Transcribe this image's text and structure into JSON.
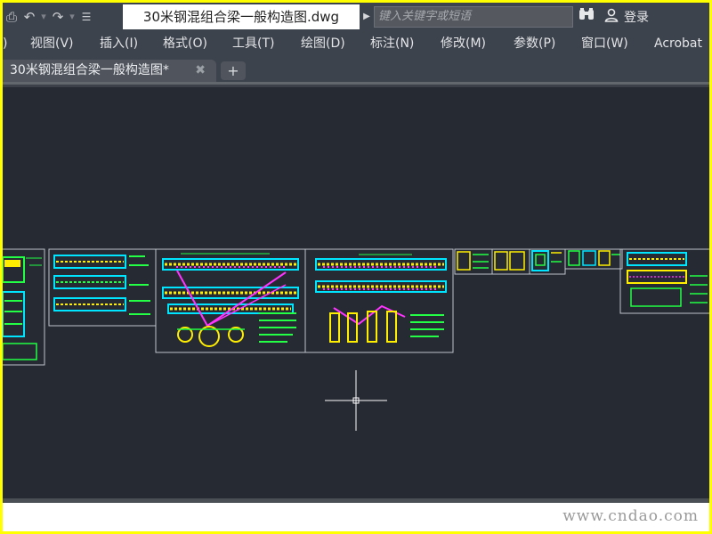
{
  "titlebar": {
    "qat_icons": [
      "print-icon",
      "undo-icon",
      "redo-icon",
      "customize-icon"
    ],
    "document_title": "30米钢混组合梁一般构造图.dwg",
    "search_placeholder": "键入关键字或短语",
    "login_label": "登录"
  },
  "menu": {
    "items": [
      {
        "label": ")",
        "name": "menu-partial"
      },
      {
        "label": "视图(V)",
        "name": "menu-view"
      },
      {
        "label": "插入(I)",
        "name": "menu-insert"
      },
      {
        "label": "格式(O)",
        "name": "menu-format"
      },
      {
        "label": "工具(T)",
        "name": "menu-tools"
      },
      {
        "label": "绘图(D)",
        "name": "menu-draw"
      },
      {
        "label": "标注(N)",
        "name": "menu-dimension"
      },
      {
        "label": "修改(M)",
        "name": "menu-modify"
      },
      {
        "label": "参数(P)",
        "name": "menu-parametric"
      },
      {
        "label": "窗口(W)",
        "name": "menu-window"
      },
      {
        "label": "Acrobat",
        "name": "menu-acrobat"
      }
    ]
  },
  "tabs": {
    "active_label": "30米钢混组合梁一般构造图*",
    "close_glyph": "✖",
    "new_glyph": "+"
  },
  "watermark": "www.cndao.com",
  "colors": {
    "canvas_bg": "#252a33",
    "chrome_bg": "#3d434c",
    "frame_border": "#ffff00"
  }
}
